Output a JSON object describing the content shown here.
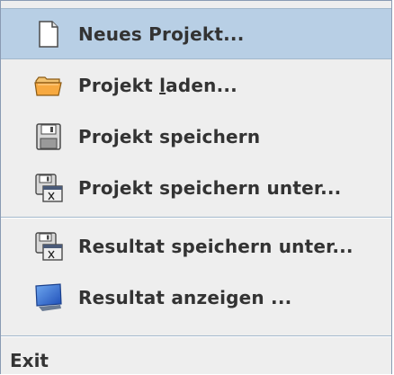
{
  "menu": {
    "items": [
      {
        "label": "Neues Projekt...",
        "icon": "new-document-icon",
        "selected": true
      },
      {
        "label_pre": "Projekt ",
        "label_mnemonic": "l",
        "label_post": "aden...",
        "icon": "open-folder-icon"
      },
      {
        "label": "Projekt speichern",
        "icon": "floppy-disk-icon"
      },
      {
        "label": "Projekt speichern unter...",
        "icon": "floppy-save-as-icon"
      },
      {
        "label": "Resultat speichern unter...",
        "icon": "floppy-save-as-icon"
      },
      {
        "label": "Resultat anzeigen ...",
        "icon": "monitor-icon"
      }
    ],
    "exit_label": "Exit"
  },
  "colors": {
    "selected_background": "#b8cfe5",
    "menu_background": "#eeeeee",
    "text": "#333333",
    "separator": "#a3b8cc"
  }
}
